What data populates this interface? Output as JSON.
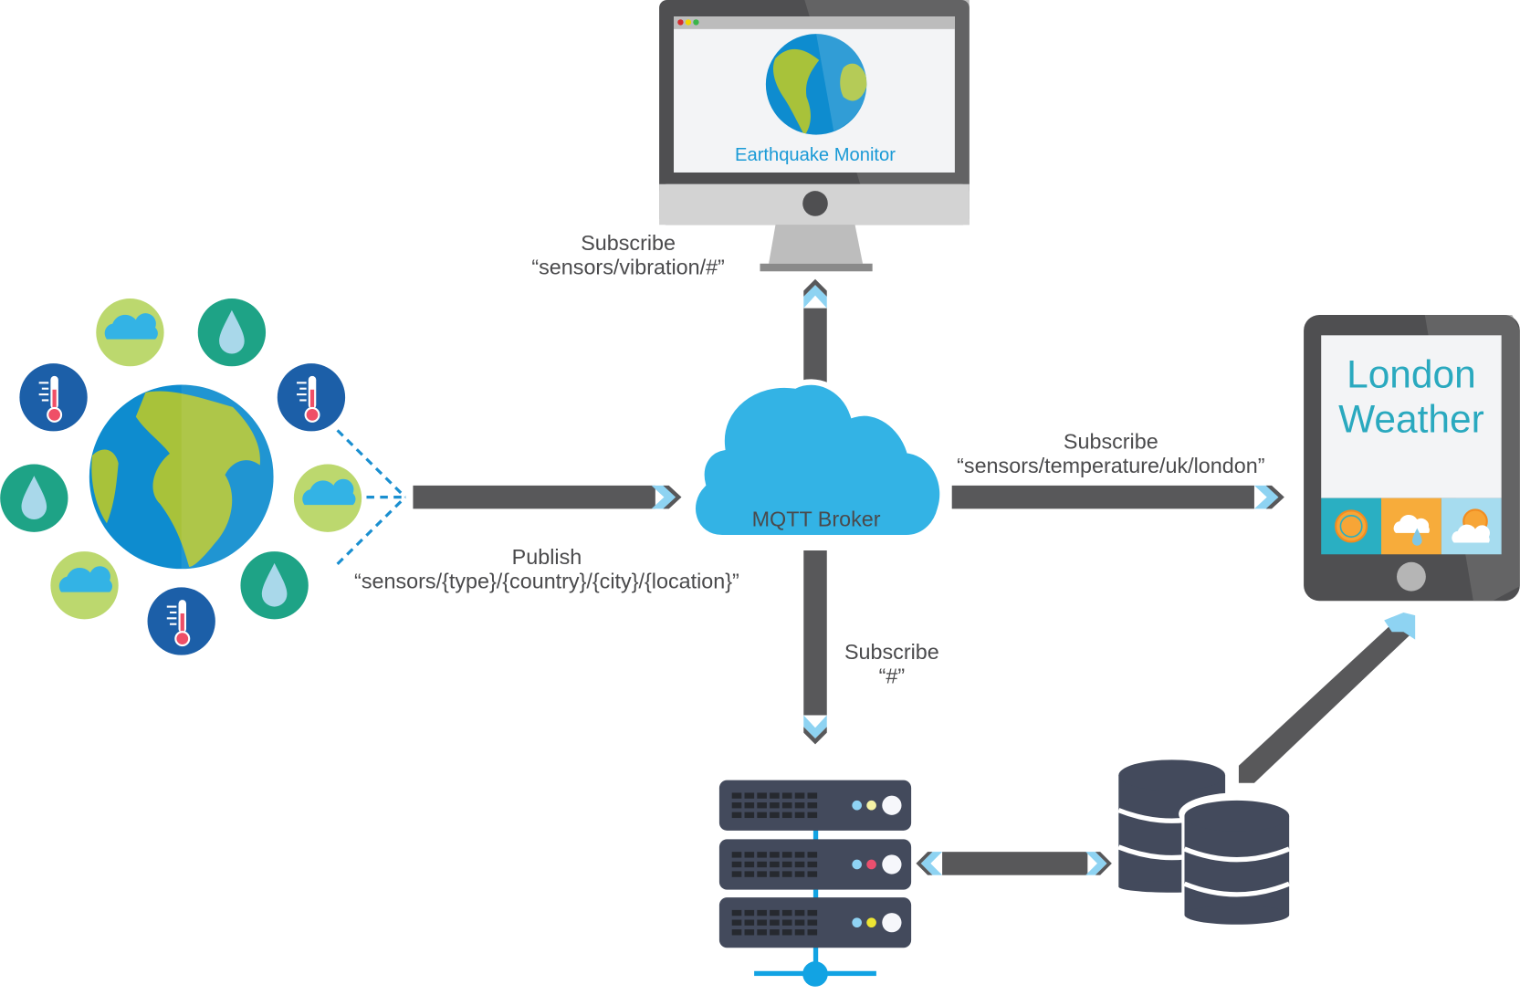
{
  "colors": {
    "arrow": "#58585a",
    "chevron": "#8ed3f2",
    "broker": "#33b3e5",
    "accent_blue": "#1a9ad6",
    "dark_slate": "#434a5c",
    "globe_ocean": "#0e8ccf",
    "globe_land": "#a8c23a",
    "label_text": "#4a4a4c"
  },
  "broker": {
    "label": "MQTT Broker",
    "icon": "cloud-icon"
  },
  "publisher": {
    "icon": "earth-globe-icon",
    "sensors": [
      {
        "type": "cloud",
        "icon": "cloud-sensor-icon"
      },
      {
        "type": "humidity",
        "icon": "water-drop-icon"
      },
      {
        "type": "temperature",
        "icon": "thermometer-icon"
      },
      {
        "type": "cloud",
        "icon": "cloud-sensor-icon"
      },
      {
        "type": "humidity",
        "icon": "water-drop-icon"
      },
      {
        "type": "temperature",
        "icon": "thermometer-icon"
      },
      {
        "type": "cloud",
        "icon": "cloud-sensor-icon"
      },
      {
        "type": "humidity",
        "icon": "water-drop-icon"
      },
      {
        "type": "temperature",
        "icon": "thermometer-icon"
      }
    ],
    "action": "Publish",
    "topic": "“sensors/{type}/{country}/{city}/{location}”"
  },
  "earthquake_monitor": {
    "title": "Earthquake Monitor",
    "device": "desktop-monitor-icon",
    "action": "Subscribe",
    "topic": "“sensors/vibration/#”"
  },
  "london_weather": {
    "title_line1": "London",
    "title_line2": "Weather",
    "device": "tablet-icon",
    "tiles": [
      {
        "icon": "sun-icon",
        "color": "#2aafc2"
      },
      {
        "icon": "rain-cloud-icon",
        "color": "#f7ac3b"
      },
      {
        "icon": "partly-cloudy-icon",
        "color": "#a6dcef"
      }
    ],
    "action": "Subscribe",
    "topic": "“sensors/temperature/uk/london”"
  },
  "server": {
    "icon": "server-rack-icon",
    "action": "Subscribe",
    "topic": "“#”"
  },
  "database": {
    "icon": "database-icon"
  }
}
